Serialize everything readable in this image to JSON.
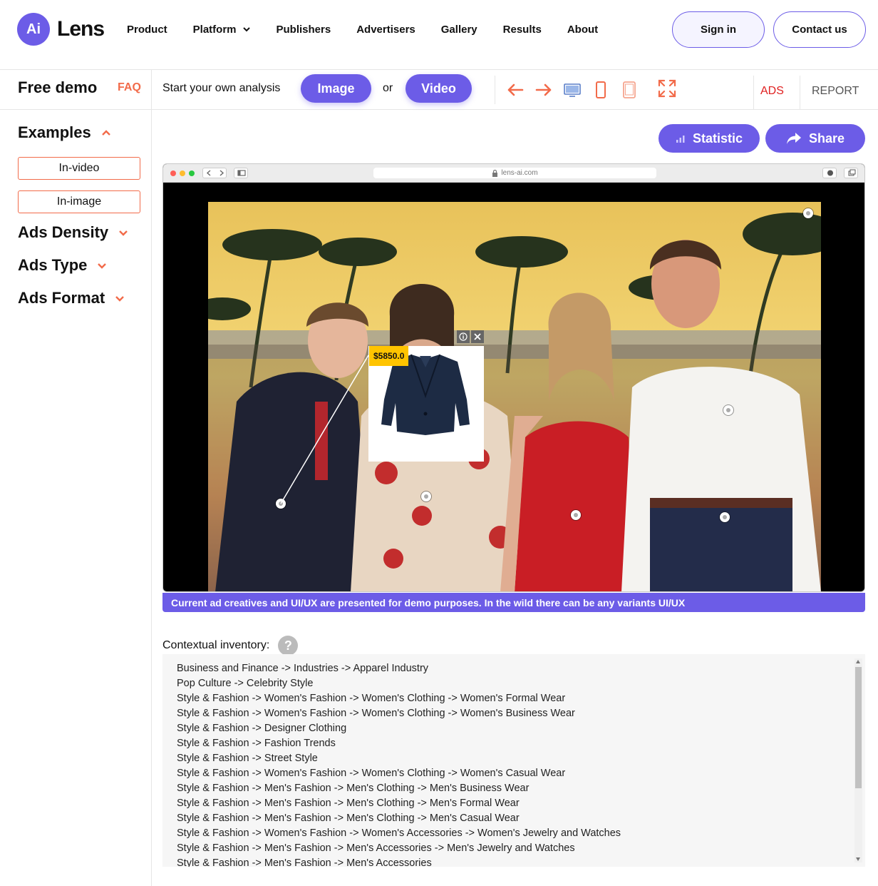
{
  "nav": {
    "logo_badge": "Ai",
    "logo_text": "Lens",
    "items": [
      "Product",
      "Platform",
      "Publishers",
      "Advertisers",
      "Gallery",
      "Results",
      "About"
    ],
    "sign_in": "Sign in",
    "contact": "Contact us"
  },
  "toolbar": {
    "free_demo": "Free demo",
    "faq": "FAQ",
    "start_text": "Start your own analysis",
    "image_btn": "Image",
    "or_text": "or",
    "video_btn": "Video",
    "tab_ads": "ADS",
    "tab_report": "REPORT"
  },
  "sidebar": {
    "examples": "Examples",
    "in_video": "In-video",
    "in_image": "In-image",
    "ads_density": "Ads Density",
    "ads_type": "Ads Type",
    "ads_format": "Ads Format"
  },
  "main": {
    "statistic": "Statistic",
    "share": "Share",
    "url": "lens-ai.com",
    "ad_price": "$5850.0",
    "notice": "Current ad creatives and UI/UX are presented for demo purposes. In the wild there can be any variants UI/UX",
    "contextual_label": "Contextual inventory:",
    "help": "?"
  },
  "contextual_inventory": [
    "Business and Finance -> Industries -> Apparel Industry",
    "Pop Culture -> Celebrity Style",
    "Style & Fashion -> Women's Fashion -> Women's Clothing -> Women's Formal Wear",
    "Style & Fashion -> Women's Fashion -> Women's Clothing -> Women's Business Wear",
    "Style & Fashion -> Designer Clothing",
    "Style & Fashion -> Fashion Trends",
    "Style & Fashion -> Street Style",
    "Style & Fashion -> Women's Fashion -> Women's Clothing -> Women's Casual Wear",
    "Style & Fashion -> Men's Fashion -> Men's Clothing -> Men's Business Wear",
    "Style & Fashion -> Men's Fashion -> Men's Clothing -> Men's Formal Wear",
    "Style & Fashion -> Men's Fashion -> Men's Clothing -> Men's Casual Wear",
    "Style & Fashion -> Women's Fashion -> Women's Accessories -> Women's Jewelry and Watches",
    "Style & Fashion -> Men's Fashion -> Men's Accessories -> Men's Jewelry and Watches",
    "Style & Fashion -> Men's Fashion -> Men's Accessories"
  ],
  "colors": {
    "brand": "#6c5ce7",
    "accent": "#f26b4a",
    "ads_tab": "#e02020",
    "price_tag": "#ffc400"
  },
  "icons": [
    "arrow-left-icon",
    "arrow-right-icon",
    "desktop-icon",
    "phone-icon",
    "tablet-icon",
    "fullscreen-icon",
    "chart-icon",
    "share-icon",
    "chevron-down-icon",
    "chevron-up-icon",
    "lock-icon",
    "info-icon",
    "close-icon"
  ]
}
